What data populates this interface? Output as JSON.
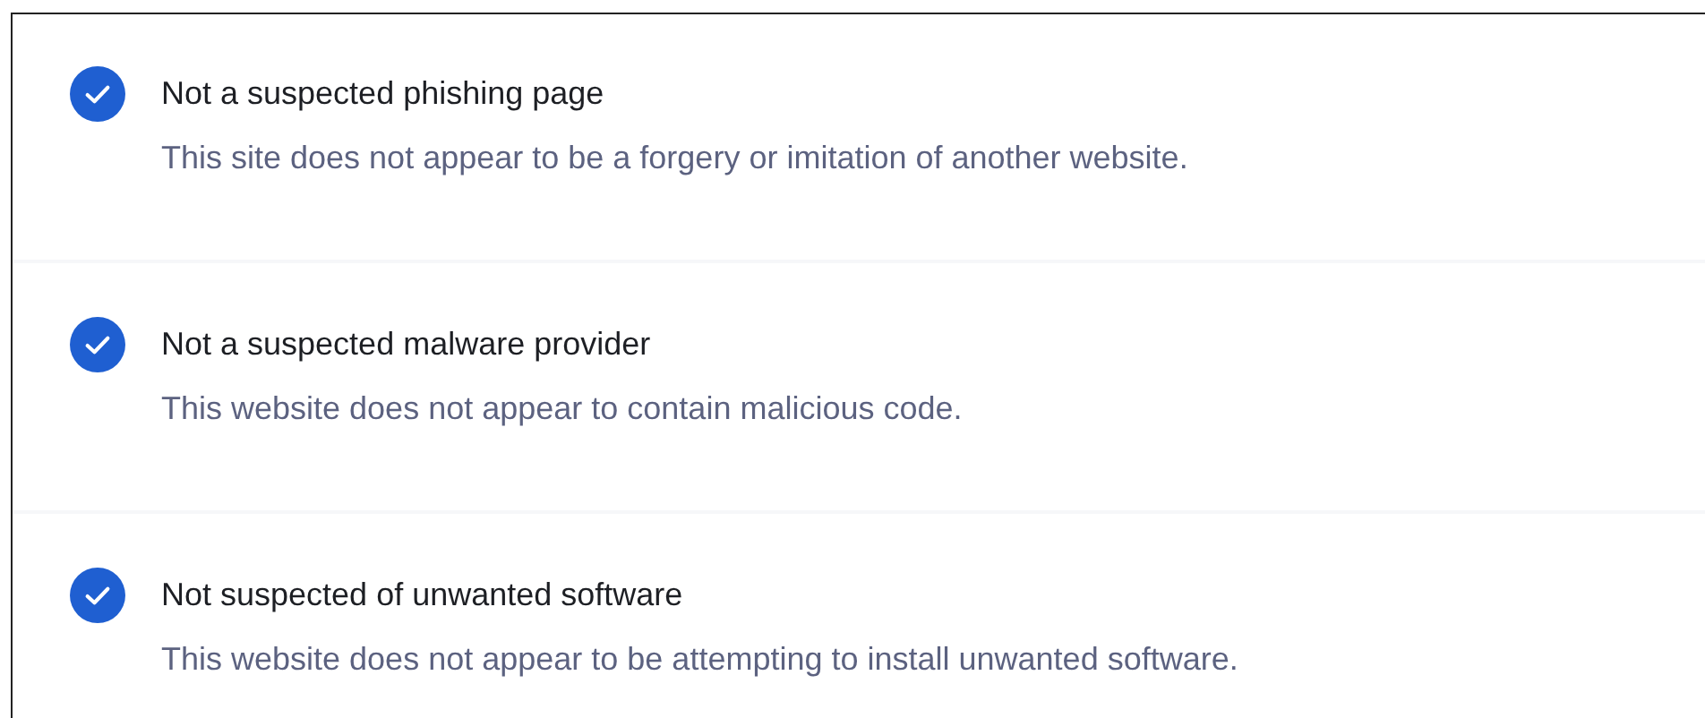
{
  "checks": [
    {
      "title": "Not a suspected phishing page",
      "description": "This site does not appear to be a forgery or imitation of another website.",
      "checked": true
    },
    {
      "title": "Not a suspected malware provider",
      "description": "This website does not appear to contain malicious code.",
      "checked": true
    },
    {
      "title": "Not suspected of unwanted software",
      "description": "This website does not appear to be attempting to install unwanted software.",
      "checked": true
    }
  ]
}
